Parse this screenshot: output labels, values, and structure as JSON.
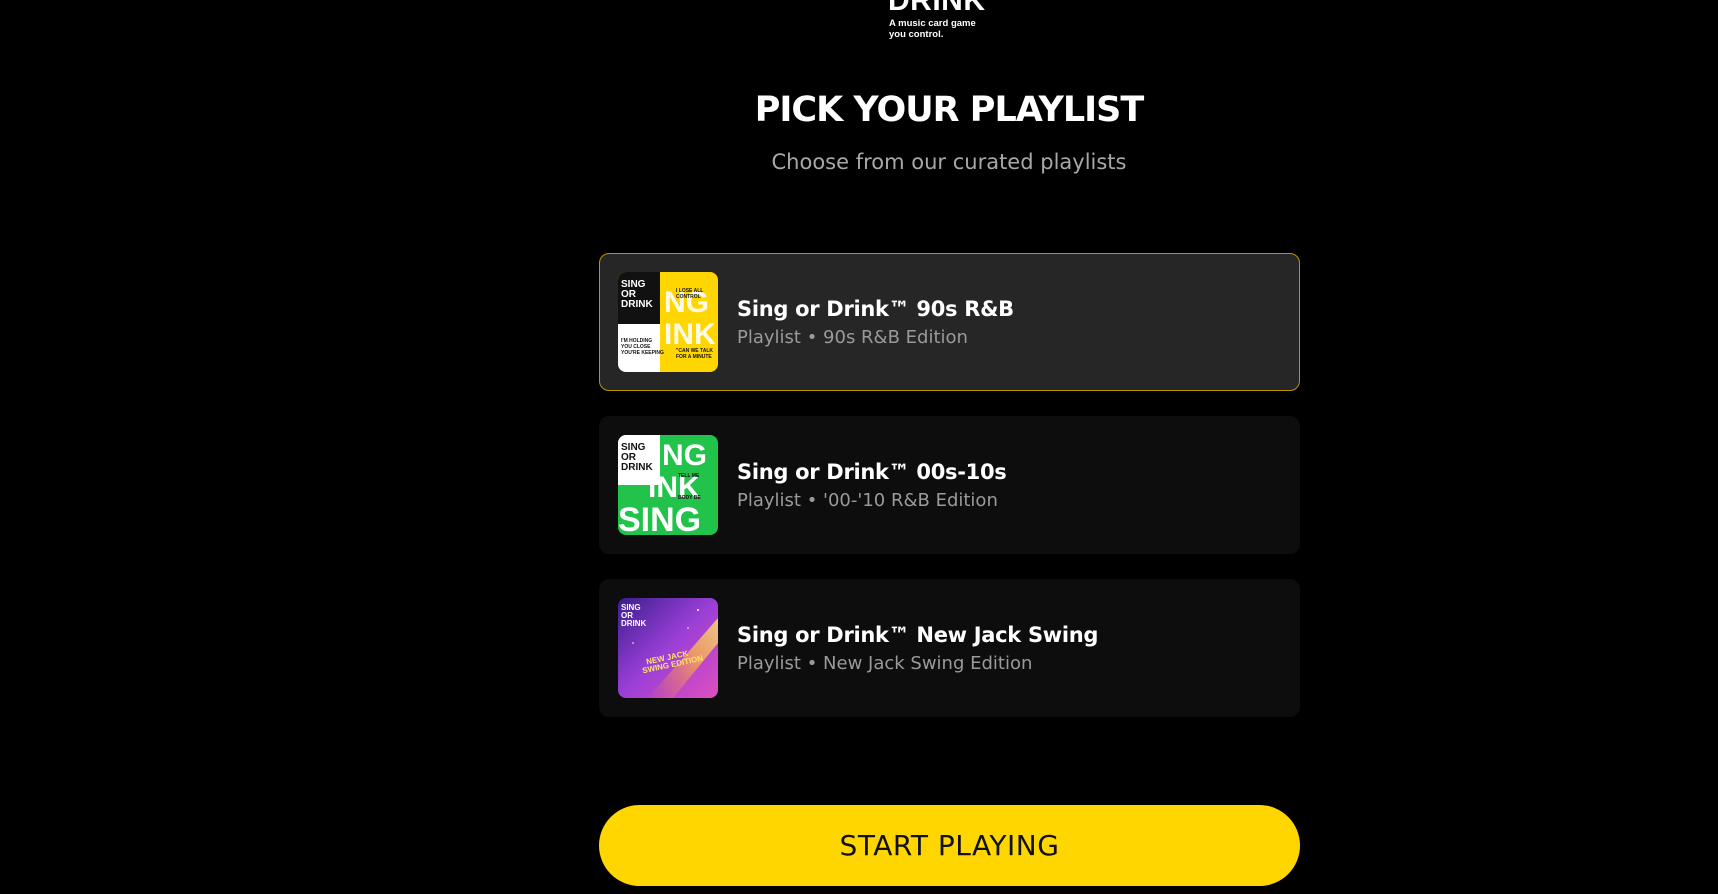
{
  "logo": {
    "word": "DRINK",
    "tagline": "A music card game\nyou control."
  },
  "heading": {
    "title": "PICK YOUR PLAYLIST",
    "subtitle": "Choose from our curated playlists"
  },
  "playlists": [
    {
      "title": "Sing or Drink™ 90s R&B",
      "subtitle": "Playlist • 90s R&B Edition",
      "selected": true,
      "cover_accent": "#ffd600",
      "cover_text": "SING OR DRINK"
    },
    {
      "title": "Sing or Drink™ 00s-10s",
      "subtitle": "Playlist • '00-'10 R&B Edition",
      "selected": false,
      "cover_accent": "#22c34a",
      "cover_text": "SING OR DRINK"
    },
    {
      "title": "Sing or Drink™ New Jack Swing",
      "subtitle": "Playlist • New Jack Swing Edition",
      "selected": false,
      "cover_accent": "#7b3fd1",
      "cover_text": "SING OR DRINK"
    }
  ],
  "start_button": {
    "label": "START PLAYING"
  },
  "colors": {
    "background": "#000000",
    "accent": "#ffd600",
    "selected_border": "#b89600",
    "card_bg": "#0d0d0d",
    "card_selected_bg": "#262626"
  }
}
